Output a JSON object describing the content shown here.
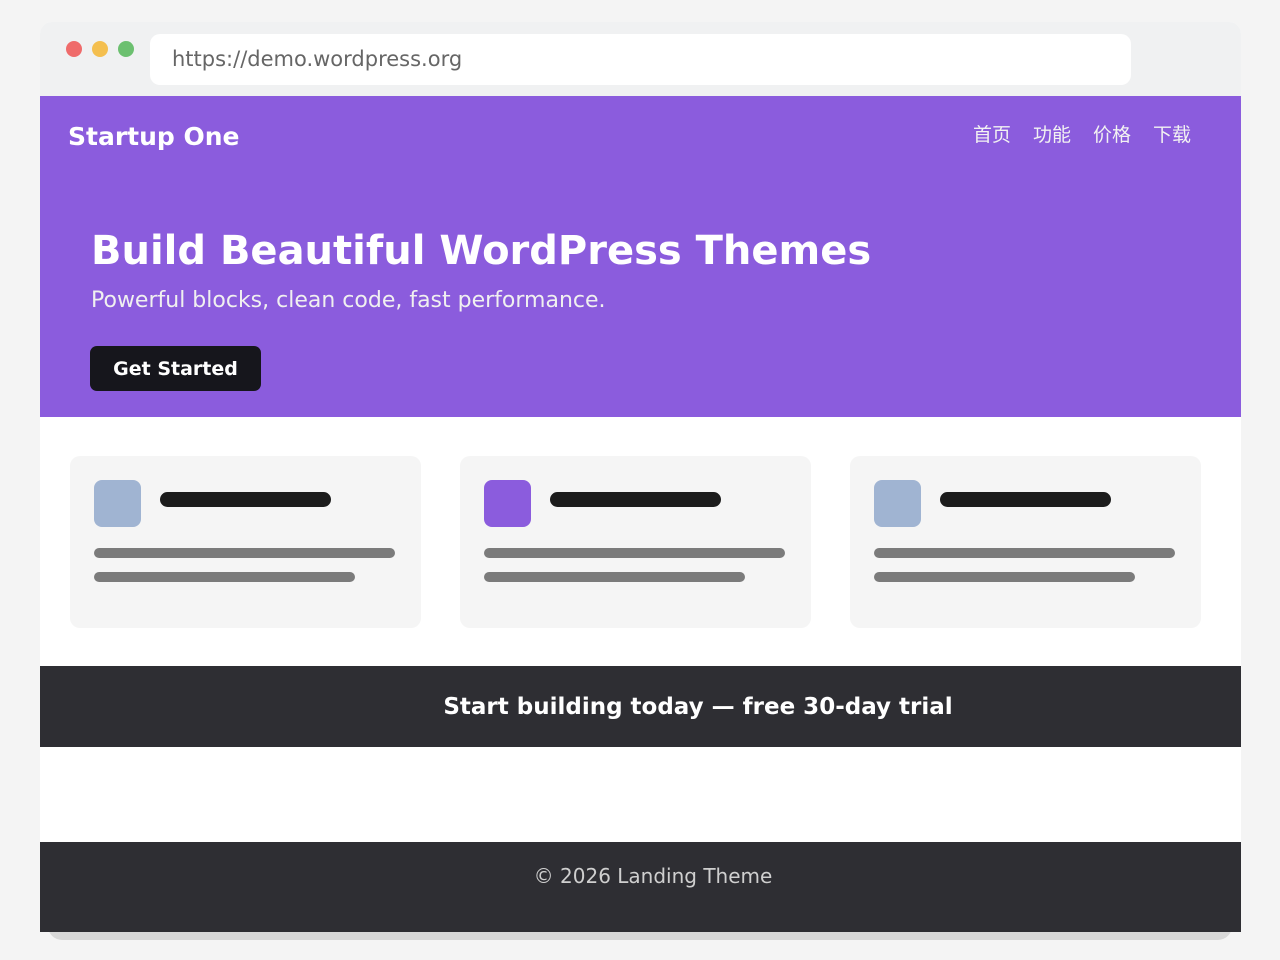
{
  "browser": {
    "url": "https://demo.wordpress.org",
    "traffic_lights": {
      "close": "#ef6b6b",
      "minimize": "#f4bf4f",
      "maximize": "#6cc070"
    }
  },
  "header": {
    "brand": "Startup One",
    "nav": [
      {
        "label": "首页"
      },
      {
        "label": "功能"
      },
      {
        "label": "价格"
      },
      {
        "label": "下载"
      }
    ]
  },
  "hero": {
    "title": "Build Beautiful WordPress Themes",
    "subtitle": "Powerful blocks, clean code, fast performance.",
    "cta_label": "Get Started"
  },
  "features": {
    "cards": [
      {
        "icon": "placeholder-square-icon",
        "icon_color": "#a0b4d2"
      },
      {
        "icon": "placeholder-square-icon",
        "icon_color": "#8b5cdd"
      },
      {
        "icon": "placeholder-square-icon",
        "icon_color": "#a0b4d2"
      }
    ]
  },
  "banner": {
    "text": "Start building today — free 30-day trial"
  },
  "footer": {
    "text": "© 2026 Landing Theme"
  },
  "colors": {
    "accent": "#8b5cdd",
    "cta_bg": "#16161c",
    "dark_band": "#2e2e33"
  }
}
